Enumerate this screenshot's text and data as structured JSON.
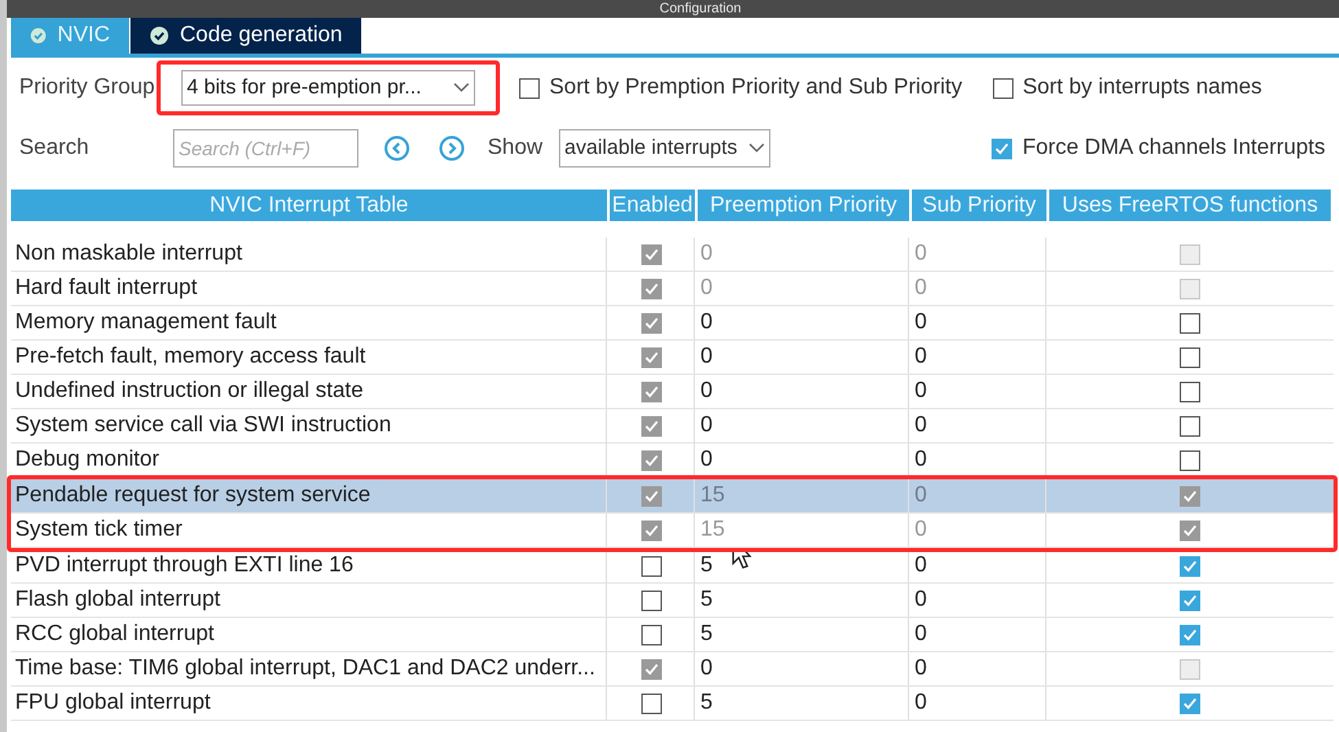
{
  "window": {
    "title": "Configuration"
  },
  "tabs": [
    {
      "label": "NVIC",
      "selected": true
    },
    {
      "label": "Code generation",
      "selected": false
    }
  ],
  "priority_group": {
    "label": "Priority Group",
    "value": "4 bits for pre-emption pr...",
    "highlighted": true
  },
  "options": [
    {
      "label": "Sort by Premption Priority and Sub Priority",
      "checked": false
    },
    {
      "label": "Sort by interrupts names",
      "checked": false
    }
  ],
  "search": {
    "label": "Search",
    "placeholder": "Search (Ctrl+F)"
  },
  "show": {
    "label": "Show",
    "value": "available interrupts"
  },
  "force_dma": {
    "label": "Force DMA channels Interrupts",
    "checked": true
  },
  "table": {
    "columns": [
      "NVIC Interrupt Table",
      "Enabled",
      "Preemption Priority",
      "Sub Priority",
      "Uses FreeRTOS functions"
    ],
    "rows": [
      {
        "name": "Non maskable interrupt",
        "enabled": true,
        "enabled_locked": true,
        "preemption": "0",
        "sub": "0",
        "priority_locked": true,
        "freertos": false,
        "freertos_locked": true,
        "selected": false,
        "highlighted": false
      },
      {
        "name": "Hard fault interrupt",
        "enabled": true,
        "enabled_locked": true,
        "preemption": "0",
        "sub": "0",
        "priority_locked": true,
        "freertos": false,
        "freertos_locked": true,
        "selected": false,
        "highlighted": false
      },
      {
        "name": "Memory management fault",
        "enabled": true,
        "enabled_locked": true,
        "preemption": "0",
        "sub": "0",
        "priority_locked": false,
        "freertos": false,
        "freertos_locked": false,
        "selected": false,
        "highlighted": false
      },
      {
        "name": "Pre-fetch fault, memory access fault",
        "enabled": true,
        "enabled_locked": true,
        "preemption": "0",
        "sub": "0",
        "priority_locked": false,
        "freertos": false,
        "freertos_locked": false,
        "selected": false,
        "highlighted": false
      },
      {
        "name": "Undefined instruction or illegal state",
        "enabled": true,
        "enabled_locked": true,
        "preemption": "0",
        "sub": "0",
        "priority_locked": false,
        "freertos": false,
        "freertos_locked": false,
        "selected": false,
        "highlighted": false
      },
      {
        "name": "System service call via SWI instruction",
        "enabled": true,
        "enabled_locked": true,
        "preemption": "0",
        "sub": "0",
        "priority_locked": false,
        "freertos": false,
        "freertos_locked": false,
        "selected": false,
        "highlighted": false
      },
      {
        "name": "Debug monitor",
        "enabled": true,
        "enabled_locked": true,
        "preemption": "0",
        "sub": "0",
        "priority_locked": false,
        "freertos": false,
        "freertos_locked": false,
        "selected": false,
        "highlighted": false
      },
      {
        "name": "Pendable request for system service",
        "enabled": true,
        "enabled_locked": true,
        "preemption": "15",
        "sub": "0",
        "priority_locked": true,
        "freertos": true,
        "freertos_locked": true,
        "selected": true,
        "highlighted": true
      },
      {
        "name": "System tick timer",
        "enabled": true,
        "enabled_locked": true,
        "preemption": "15",
        "sub": "0",
        "priority_locked": true,
        "freertos": true,
        "freertos_locked": true,
        "selected": false,
        "highlighted": true
      },
      {
        "name": "PVD interrupt through EXTI line 16",
        "enabled": false,
        "enabled_locked": false,
        "preemption": "5",
        "sub": "0",
        "priority_locked": false,
        "freertos": true,
        "freertos_locked": false,
        "selected": false,
        "highlighted": false
      },
      {
        "name": "Flash global interrupt",
        "enabled": false,
        "enabled_locked": false,
        "preemption": "5",
        "sub": "0",
        "priority_locked": false,
        "freertos": true,
        "freertos_locked": false,
        "selected": false,
        "highlighted": false
      },
      {
        "name": "RCC global interrupt",
        "enabled": false,
        "enabled_locked": false,
        "preemption": "5",
        "sub": "0",
        "priority_locked": false,
        "freertos": true,
        "freertos_locked": false,
        "selected": false,
        "highlighted": false
      },
      {
        "name": "Time base: TIM6 global interrupt, DAC1 and DAC2 underr...",
        "enabled": true,
        "enabled_locked": true,
        "preemption": "0",
        "sub": "0",
        "priority_locked": false,
        "freertos": false,
        "freertos_locked": true,
        "selected": false,
        "highlighted": false
      },
      {
        "name": "FPU global interrupt",
        "enabled": false,
        "enabled_locked": false,
        "preemption": "5",
        "sub": "0",
        "priority_locked": false,
        "freertos": true,
        "freertos_locked": false,
        "selected": false,
        "highlighted": false
      }
    ]
  }
}
